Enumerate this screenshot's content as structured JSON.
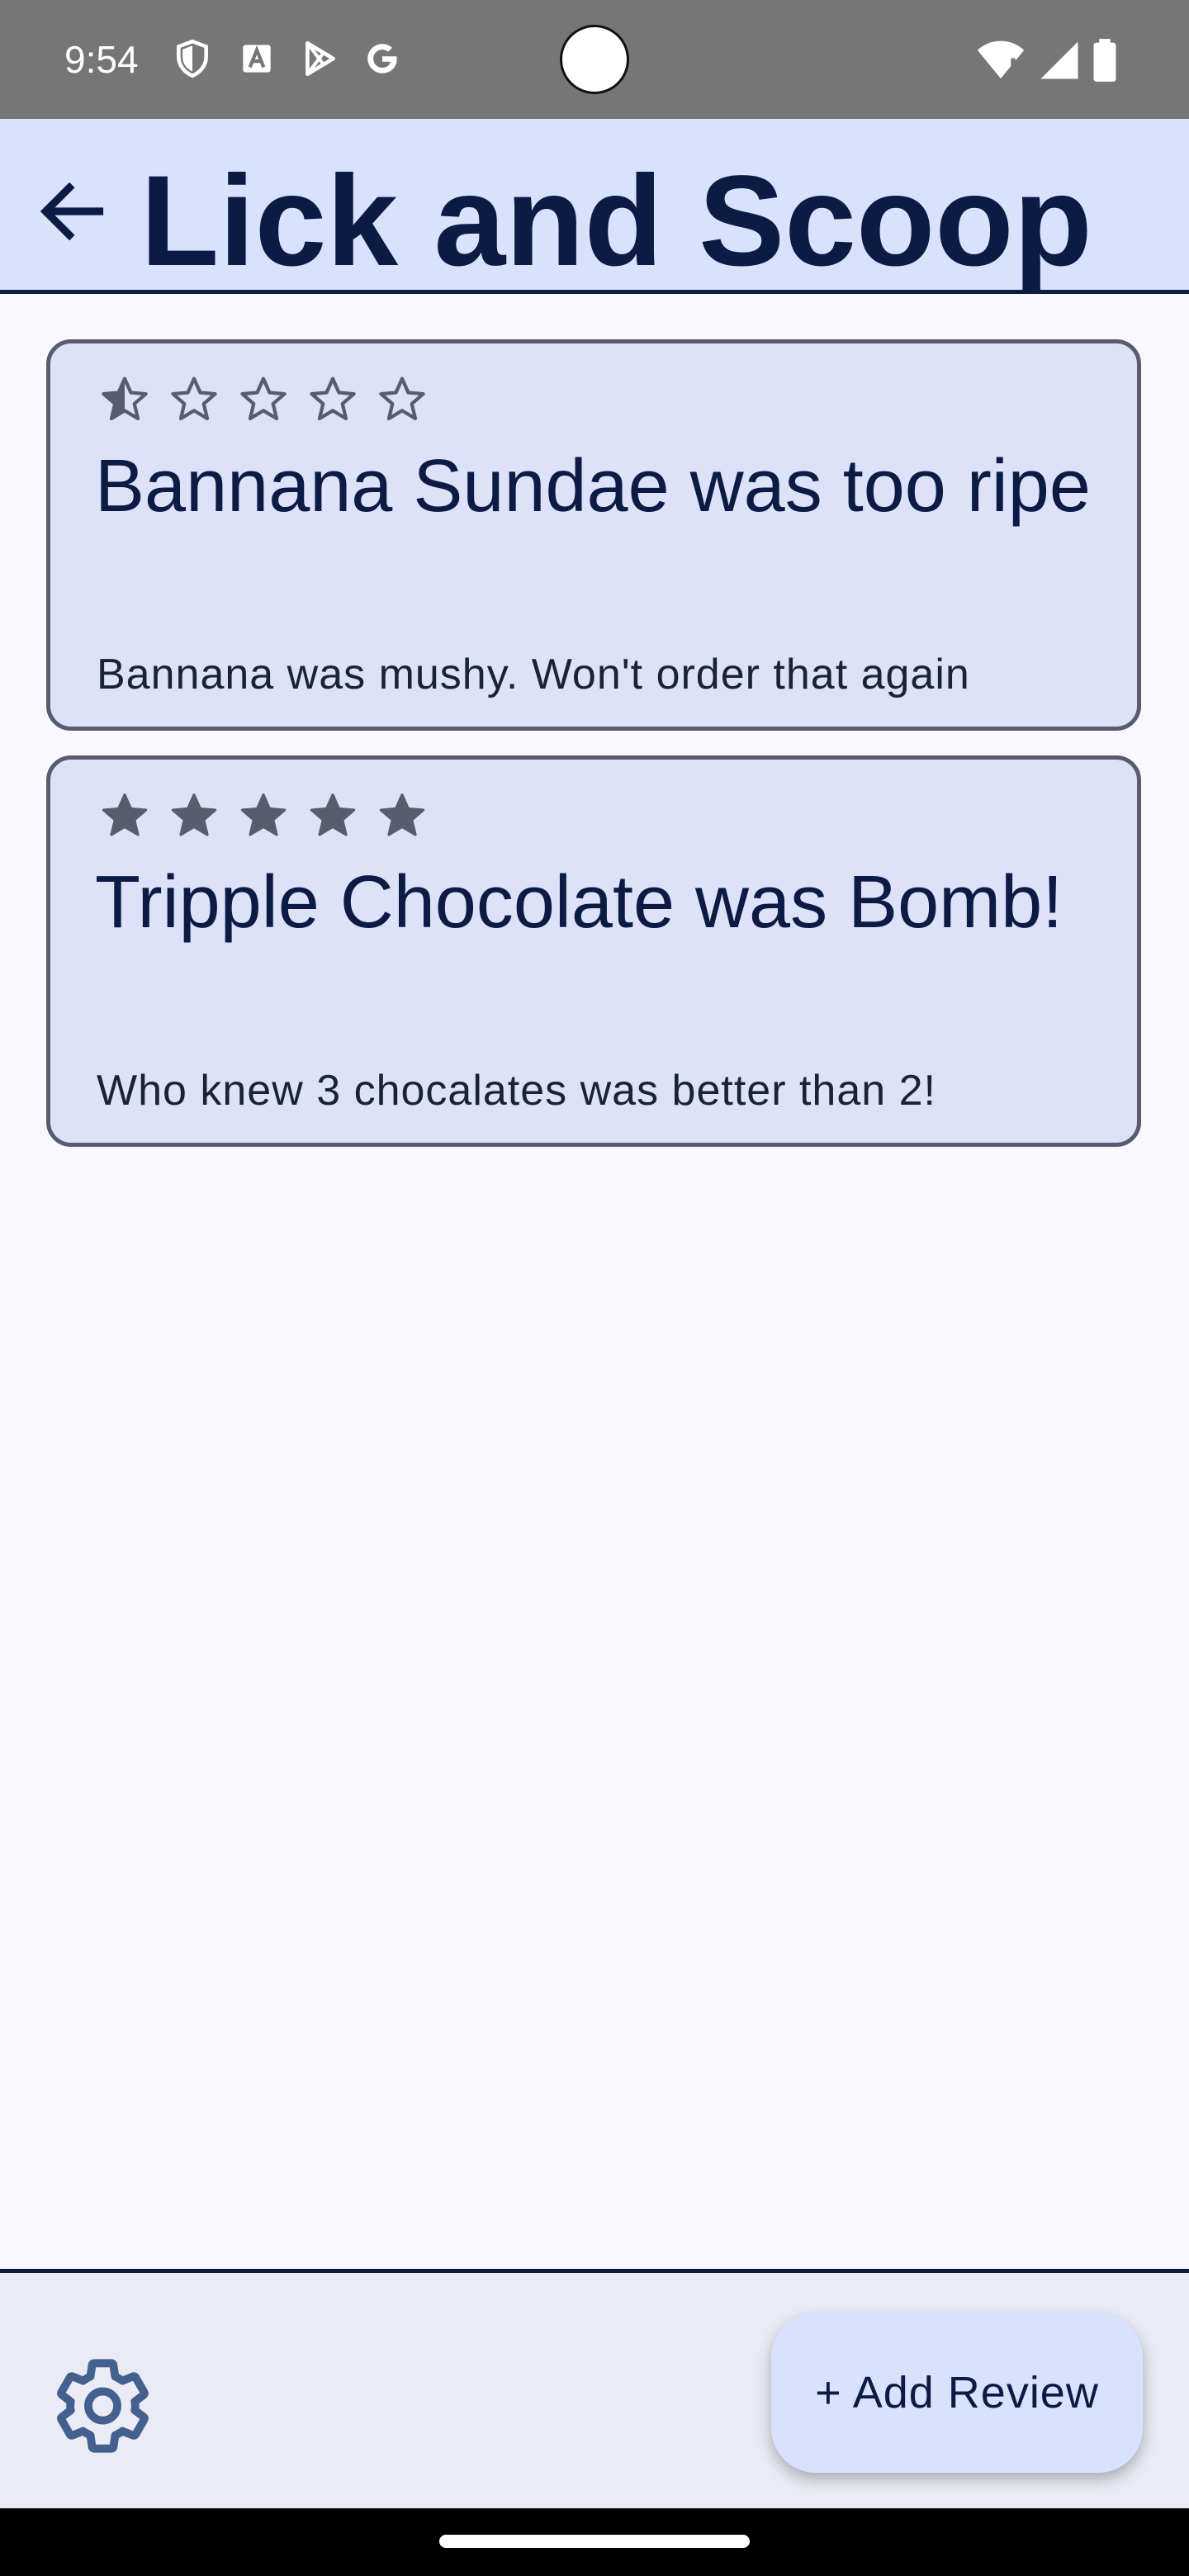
{
  "status_bar": {
    "time": "9:54",
    "left_icons": [
      "shield-icon",
      "font-icon",
      "play-store-icon",
      "google-icon"
    ],
    "right_icons": [
      "wifi-icon",
      "signal-icon",
      "battery-icon"
    ]
  },
  "app_bar": {
    "title": "Lick and Scoop",
    "back_icon": "arrow-back-icon"
  },
  "reviews": [
    {
      "rating": 0.5,
      "max_rating": 5,
      "title": "Bannana Sundae was too ripe",
      "body": "Bannana was mushy. Won't order that again"
    },
    {
      "rating": 5,
      "max_rating": 5,
      "title": "Tripple Chocolate was Bomb!",
      "body": "Who knew 3 chocalates was better than 2!"
    }
  ],
  "bottom_bar": {
    "settings_icon": "gear-icon",
    "add_review_label": "+ Add Review"
  },
  "colors": {
    "app_bar_bg": "#d9e2fd",
    "card_bg": "#dde2f9",
    "card_border": "#575c6e",
    "title_text": "#0c1b44",
    "star": "#575c6e",
    "settings_icon": "#44608f"
  }
}
